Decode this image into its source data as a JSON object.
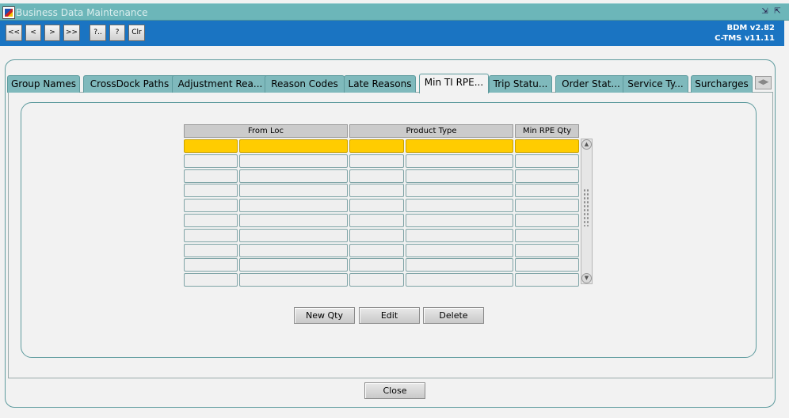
{
  "window": {
    "title": "Business Data Maintenance",
    "controls": [
      "minimize-icon",
      "maximize-icon"
    ]
  },
  "toolbar": {
    "buttons": [
      "<<",
      "<",
      ">",
      ">>",
      "?..",
      "?",
      "Clr"
    ],
    "version_line1": "BDM v2.82",
    "version_line2": "C-TMS v11.11"
  },
  "tabs": [
    {
      "label": "Group Names"
    },
    {
      "label": "CrossDock Paths"
    },
    {
      "label": "Adjustment Rea..."
    },
    {
      "label": "Reason Codes"
    },
    {
      "label": "Late Reasons"
    },
    {
      "label": "Min TI RPE..."
    },
    {
      "label": "Trip Statu..."
    },
    {
      "label": "Order Stat..."
    },
    {
      "label": "Service Ty..."
    },
    {
      "label": "Surcharges"
    }
  ],
  "active_tab": "Min TI RPE...",
  "grid": {
    "columns": [
      "From Loc",
      "Product Type",
      "Min RPE Qty"
    ],
    "row_count": 10,
    "selected_row": 1,
    "selected_color": "#ffcc00"
  },
  "actions": {
    "new_label": "New Qty",
    "edit_label": "Edit",
    "delete_label": "Delete"
  },
  "footer": {
    "close_label": "Close"
  }
}
